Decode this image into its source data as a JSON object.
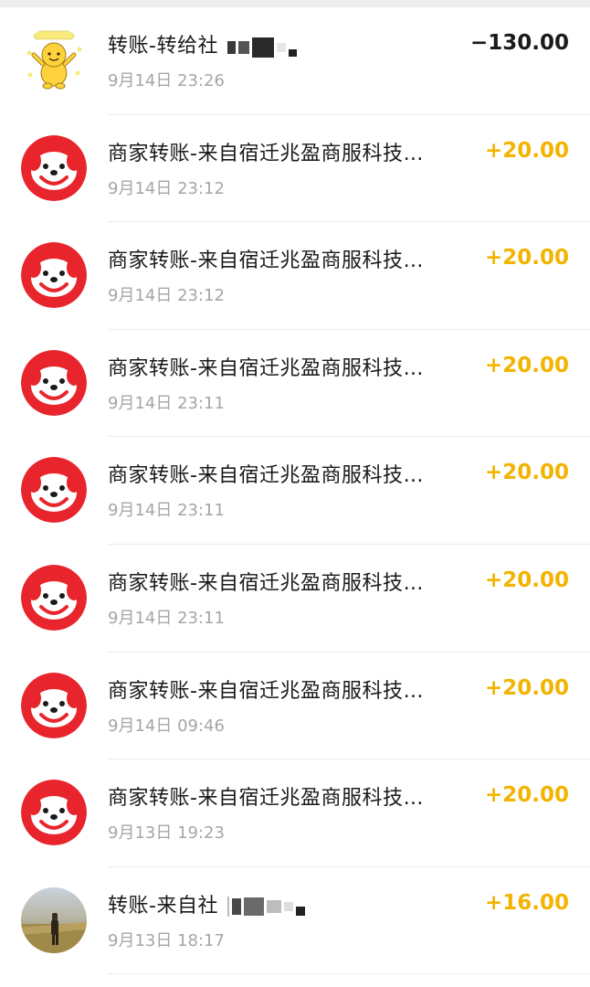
{
  "colors": {
    "positive_amount": "#f2b400",
    "negative_amount": "#1a1a1a",
    "secondary_text": "#a6a6a6",
    "brand_red": "#e8242c"
  },
  "transactions": [
    {
      "title": "转账-转给社",
      "time": "9月14日 23:26",
      "amount": "−130.00",
      "avatar": "yellow-bear-sticker-icon"
    },
    {
      "title": "商家转账-来自宿迁兆盈商服科技…",
      "time": "9月14日 23:12",
      "amount": "+20.00",
      "avatar": "jd-dog-logo-icon"
    },
    {
      "title": "商家转账-来自宿迁兆盈商服科技…",
      "time": "9月14日 23:12",
      "amount": "+20.00",
      "avatar": "jd-dog-logo-icon"
    },
    {
      "title": "商家转账-来自宿迁兆盈商服科技…",
      "time": "9月14日 23:11",
      "amount": "+20.00",
      "avatar": "jd-dog-logo-icon"
    },
    {
      "title": "商家转账-来自宿迁兆盈商服科技…",
      "time": "9月14日 23:11",
      "amount": "+20.00",
      "avatar": "jd-dog-logo-icon"
    },
    {
      "title": "商家转账-来自宿迁兆盈商服科技…",
      "time": "9月14日 23:11",
      "amount": "+20.00",
      "avatar": "jd-dog-logo-icon"
    },
    {
      "title": "商家转账-来自宿迁兆盈商服科技…",
      "time": "9月14日 09:46",
      "amount": "+20.00",
      "avatar": "jd-dog-logo-icon"
    },
    {
      "title": "商家转账-来自宿迁兆盈商服科技…",
      "time": "9月13日 19:23",
      "amount": "+20.00",
      "avatar": "jd-dog-logo-icon"
    },
    {
      "title": "转账-来自社",
      "time": "9月13日 18:17",
      "amount": "+16.00",
      "avatar": "user-photo-avatar-icon"
    }
  ]
}
